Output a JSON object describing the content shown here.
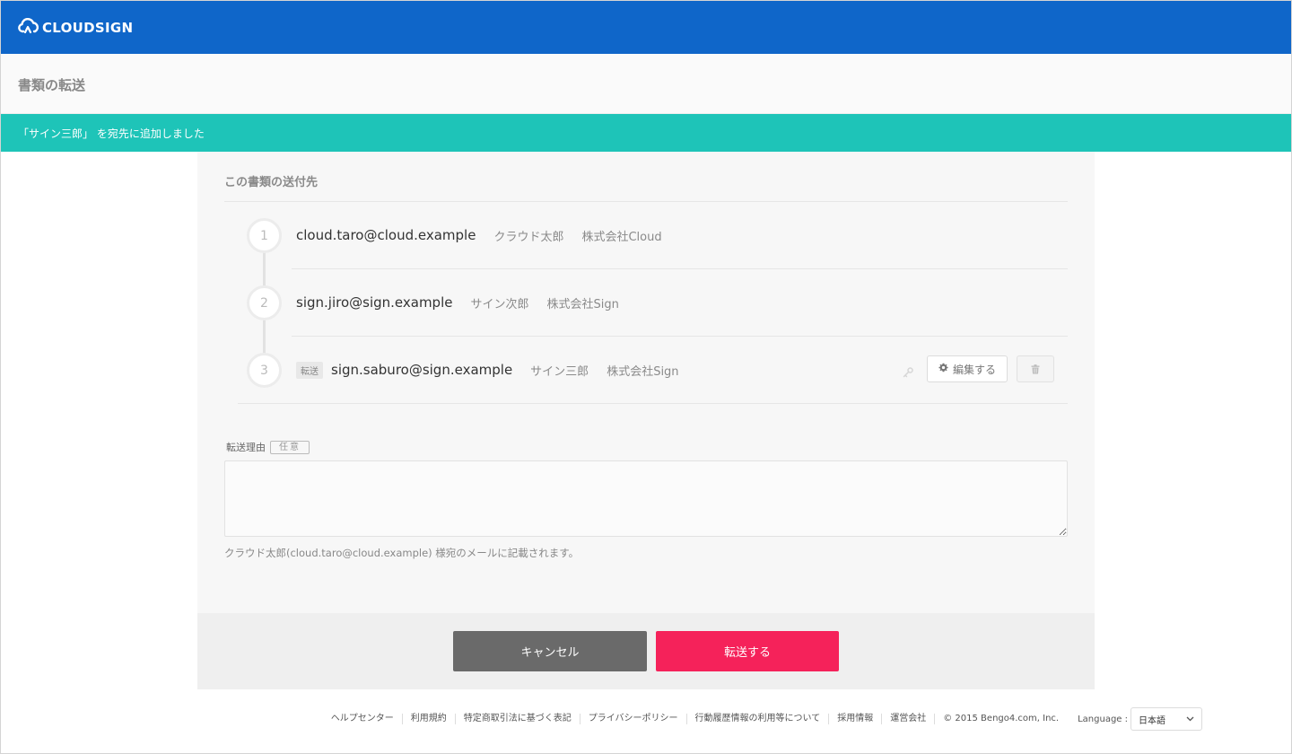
{
  "header": {
    "logo_text": "CLOUDSIGN",
    "page_title": "書類の転送"
  },
  "notice": {
    "text": "「サイン三郎」 を宛先に追加しました"
  },
  "recipients_section": {
    "title": "この書類の送付先",
    "recipients": [
      {
        "step": "1",
        "email": "cloud.taro@cloud.example",
        "name": "クラウド太郎",
        "company": "株式会社Cloud",
        "tag": ""
      },
      {
        "step": "2",
        "email": "sign.jiro@sign.example",
        "name": "サイン次郎",
        "company": "株式会社Sign",
        "tag": ""
      },
      {
        "step": "3",
        "email": "sign.saburo@sign.example",
        "name": "サイン三郎",
        "company": "株式会社Sign",
        "tag": "転送"
      }
    ],
    "edit_label": "編集する"
  },
  "reason": {
    "label": "転送理由",
    "optional_badge": "任意",
    "value": "",
    "note": "クラウド太郎(cloud.taro@cloud.example) 様宛のメールに記載されます。"
  },
  "actions": {
    "cancel_label": "キャンセル",
    "submit_label": "転送する"
  },
  "footer": {
    "links": [
      "ヘルプセンター",
      "利用規約",
      "特定商取引法に基づく表記",
      "プライバシーポリシー",
      "行動履歴情報の利用等について",
      "採用情報",
      "運営会社"
    ],
    "copyright": "© 2015 Bengo4.com, Inc.",
    "language_label": "Language :",
    "language_value": "日本語"
  },
  "colors": {
    "brand_blue": "#0f66c9",
    "notice_teal": "#1ec4b8",
    "submit_pink": "#f5225a",
    "cancel_gray": "#6a6a6a"
  }
}
